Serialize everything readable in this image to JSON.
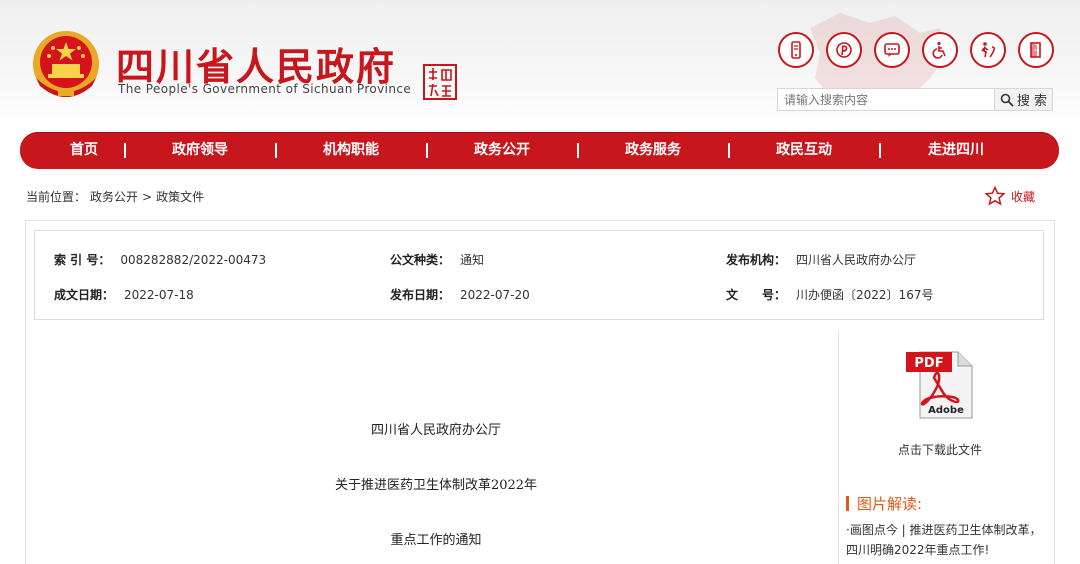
{
  "header": {
    "title": "四川省人民政府",
    "subtitle": "The People's Government of Sichuan Province",
    "top_icons": [
      "mobile-icon",
      "weibo-icon",
      "message-icon",
      "accessibility-icon",
      "elder-icon",
      "exit-icon"
    ],
    "search_placeholder": "请输入搜索内容",
    "search_button": "搜 索"
  },
  "nav": {
    "items": [
      "首页",
      "政府领导",
      "机构职能",
      "政务公开",
      "政务服务",
      "政民互动",
      "走进四川"
    ]
  },
  "breadcrumb": {
    "label": "当前位置：",
    "path1": "政务公开",
    "sep": ">",
    "path2": "政策文件"
  },
  "favorite": {
    "label": "收藏"
  },
  "meta": {
    "index_key": "索 引 号：",
    "index_value": "008282882/2022-00473",
    "type_key": "公文种类：",
    "type_value": "通知",
    "issuer_key": "发布机构：",
    "issuer_value": "四川省人民政府办公厅",
    "created_key": "成文日期：",
    "created_value": "2022-07-18",
    "published_key": "发布日期：",
    "published_value": "2022-07-20",
    "docno_key": "文　　号：",
    "docno_value": "川办便函〔2022〕167号"
  },
  "document": {
    "line1": "四川省人民政府办公厅",
    "line2": "关于推进医药卫生体制改革2022年",
    "line3": "重点工作的通知"
  },
  "sidebar": {
    "pdf_label": "点击下载此文件",
    "pdf_badge": "PDF",
    "pdf_brand": "Adobe",
    "pic_title": "图片解读:",
    "pic_link": "·画图点今 | 推进医药卫生体制改革，四川明确2022年重点工作!"
  },
  "colors": {
    "brand_red": "#c8161d",
    "accent_orange": "#e05a17"
  }
}
